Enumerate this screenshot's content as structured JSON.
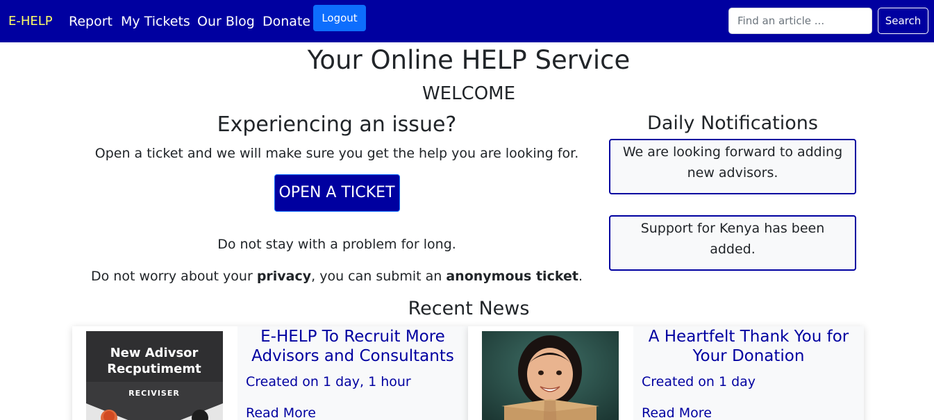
{
  "nav": {
    "brand": "E-HELP",
    "links": [
      "Report",
      "My Tickets",
      "Our Blog",
      "Donate"
    ],
    "logout_label": "Logout",
    "search_placeholder": "Find an article ...",
    "search_label": "Search"
  },
  "hero": {
    "title": "Your Online HELP Service",
    "welcome": "WELCOME"
  },
  "issue": {
    "title": "Experiencing an issue?",
    "text": "Open a ticket and we will make sure you get the help you are looking for.",
    "button_label": "OPEN A TICKET",
    "line1": "Do not stay with a problem for long.",
    "line2_pre": "Do not worry about your ",
    "line2_bold1": "privacy",
    "line2_mid": ", you can submit an ",
    "line2_bold2": "anonymous ticket",
    "line2_post": "."
  },
  "notifications": {
    "title": "Daily Notifications",
    "items": [
      "We are looking forward to adding new advisors.",
      "Support for Kenya has been added."
    ]
  },
  "news": {
    "title": "Recent News",
    "articles": [
      {
        "title": "E-HELP To Recruit More Advisors and Consultants",
        "date": "Created on 1 day, 1 hour",
        "more": "Read More",
        "image_text_1": "New Adivsor",
        "image_text_2": "Recputimemt",
        "image_text_3": "RECIVISER"
      },
      {
        "title": "A Heartfelt Thank You for Your Donation",
        "date": "Created on 1 day",
        "more": "Read More"
      }
    ]
  },
  "colors": {
    "nav_bg": "#0000a0",
    "brand": "#ffff66",
    "primary": "#0d6efd",
    "link": "#0000a0"
  }
}
